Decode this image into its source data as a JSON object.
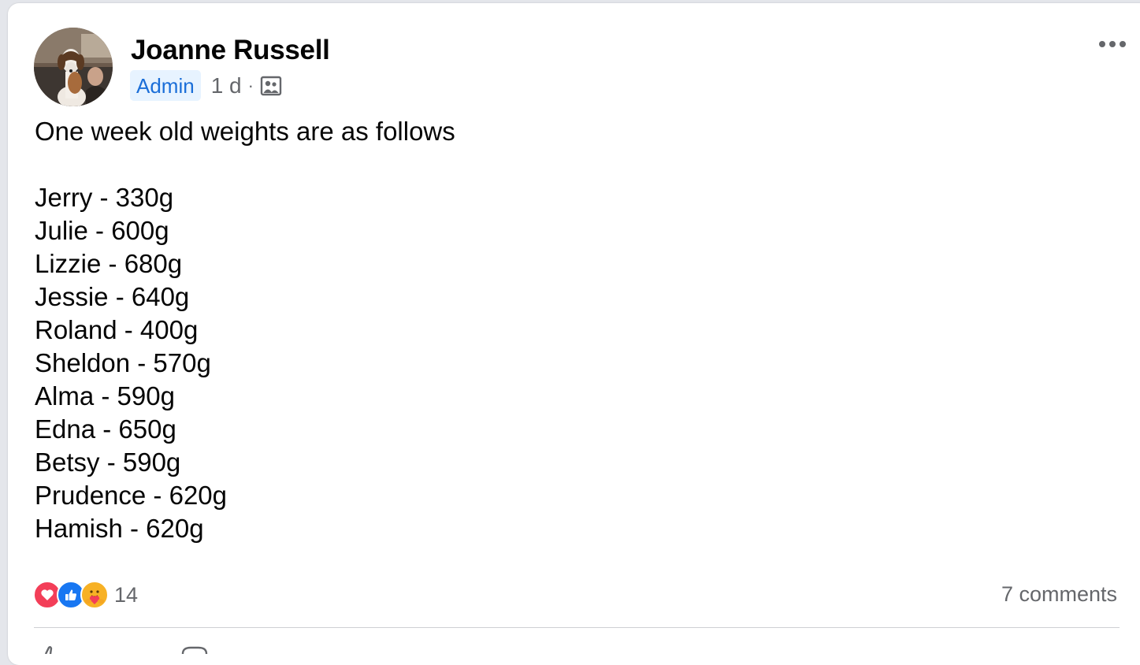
{
  "post": {
    "author": "Joanne Russell",
    "badge": "Admin",
    "time": "1 d",
    "separator": "·",
    "audience_icon": "group-audience-icon",
    "more_icon": "more-options-icon",
    "intro": "One week old weights are as follows",
    "weights": [
      "Jerry - 330g",
      "Julie - 600g",
      "Lizzie - 680g",
      "Jessie - 640g",
      "Roland - 400g",
      "Sheldon - 570g",
      "Alma - 590g",
      "Edna - 650g",
      "Betsy - 590g",
      "Prudence - 620g",
      "Hamish - 620g"
    ]
  },
  "footer": {
    "reaction_icons": [
      "love-reaction-icon",
      "like-reaction-icon",
      "care-reaction-icon"
    ],
    "reaction_count": "14",
    "comments": "7 comments"
  },
  "colors": {
    "badge_bg": "#e7f3ff",
    "badge_text": "#1a6ed8",
    "secondary_text": "#65676b",
    "love": "#f33e58",
    "like": "#1877f2",
    "care": "#f7b125"
  }
}
